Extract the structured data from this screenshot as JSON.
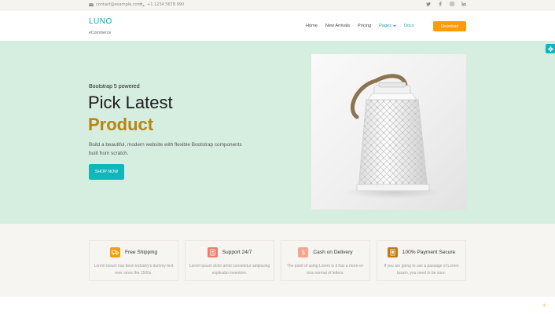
{
  "topbar": {
    "email": "contact@example.com",
    "phone": "+1 1234 5678 990",
    "social_icons": [
      "twitter-icon",
      "facebook-icon",
      "instagram-icon",
      "linkedin-icon"
    ]
  },
  "header": {
    "brand": "LUNO",
    "brand_sub": "eCommerce",
    "nav": {
      "home": "Home",
      "new_arrivals": "New Arrivals",
      "pricing": "Pricing",
      "pages": "Pages",
      "docs": "Docs"
    },
    "download_label": "Download"
  },
  "hero": {
    "tagline": "Bootstrap 5 powered",
    "title_line1": "Pick Latest",
    "title_line2": "Product",
    "description": "Build a beautiful, modern website with flexible Bootstrap components built from scratch.",
    "button_label": "SHOP NOW"
  },
  "features": [
    {
      "title": "Free Shipping",
      "desc": "Lorem Ipsum has been industry's dummy text ever since the 1500s.",
      "icon": "truck-icon",
      "color": "#f59e0b"
    },
    {
      "title": "Support 24/7",
      "desc": "Lorem ipsum dolor amet consetetur adipiscing explicabo inventore.",
      "icon": "support-icon",
      "color": "#ef7b6c"
    },
    {
      "title": "Cash on Delivery",
      "desc": "The point of using Lorem is it has a more-or-less normal of letters.",
      "icon": "dollar-icon",
      "color": "#f9a38c"
    },
    {
      "title": "100% Payment Secure",
      "desc": "If you are going to use a passage of Lorem Ipsum, you need to be sure.",
      "icon": "secure-icon",
      "color": "#c27a12"
    }
  ],
  "colors": {
    "accent": "#11b6bb",
    "brand": "#0ea5b5",
    "download": "#fb9a0b",
    "hero_bg": "#d5eee0",
    "product_word": "#b8860b"
  }
}
